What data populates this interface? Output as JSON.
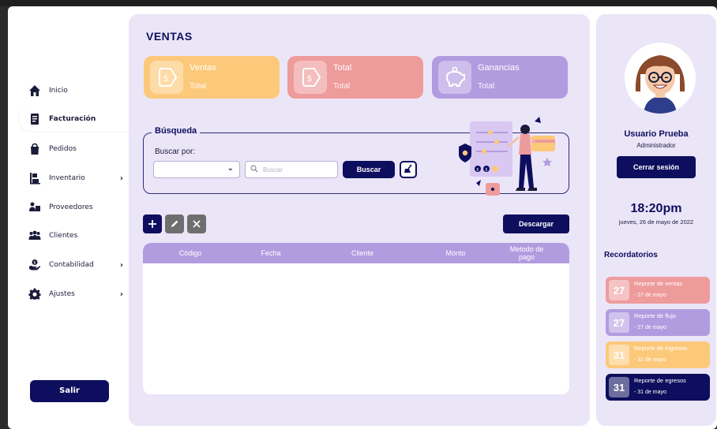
{
  "sidebar": {
    "items": [
      {
        "label": "Inicio",
        "icon": "home-icon",
        "has_submenu": false
      },
      {
        "label": "Facturación",
        "icon": "invoice-icon",
        "has_submenu": false,
        "active": true
      },
      {
        "label": "Pedidos",
        "icon": "shopping-bag-icon",
        "has_submenu": false
      },
      {
        "label": "Inventario",
        "icon": "inventory-icon",
        "has_submenu": true
      },
      {
        "label": "Proveedores",
        "icon": "suppliers-icon",
        "has_submenu": false
      },
      {
        "label": "Clientes",
        "icon": "clients-icon",
        "has_submenu": false
      },
      {
        "label": "Contabilidad",
        "icon": "accounting-icon",
        "has_submenu": true
      },
      {
        "label": "Ajustes",
        "icon": "gear-icon",
        "has_submenu": true
      }
    ],
    "chevron": "›",
    "logout_label": "Salir"
  },
  "main": {
    "title": "VENTAS",
    "cards": [
      {
        "label": "Ventas",
        "sub": "Total",
        "color": "#fcc97a",
        "icon": "price-tag-icon"
      },
      {
        "label": "Total",
        "sub": "Total",
        "color": "#ee9b9b",
        "icon": "price-tag-icon"
      },
      {
        "label": "Ganancias",
        "sub": "Total",
        "color": "#b29ce0",
        "icon": "piggy-bank-icon"
      }
    ],
    "search": {
      "legend": "Búsqueda",
      "by_label": "Buscar por:",
      "select_value": "",
      "input_placeholder": "Buscar",
      "button_label": "Buscar"
    },
    "toolbar": {
      "add_icon": "plus-icon",
      "edit_icon": "pencil-icon",
      "delete_icon": "x-icon",
      "download_label": "Descargar"
    },
    "table": {
      "columns": [
        "Código",
        "Fecha",
        "Cliente",
        "Monto",
        "Metodo de pago"
      ],
      "rows": []
    }
  },
  "user": {
    "name": "Usuario Prueba",
    "role": "Administrador",
    "logout_label": "Cerrar sesión",
    "time": "18:20pm",
    "date": "jueves, 26 de mayo de 2022"
  },
  "reminders": {
    "title": "Recordatorios",
    "items": [
      {
        "day": "27",
        "label": "Reporte de ventas",
        "date": "- 27 de mayo",
        "color": "#ee9b9b"
      },
      {
        "day": "27",
        "label": "Reporte de flujo",
        "date": "- 27 de mayo",
        "color": "#b29ce0"
      },
      {
        "day": "31",
        "label": "Reporte de ingresos",
        "date": "- 31 de mayo",
        "color": "#fcc97a"
      },
      {
        "day": "31",
        "label": "Reporte de egresos",
        "date": "- 31 de mayo",
        "color": "#0e0e5e"
      }
    ]
  },
  "colors": {
    "navy": "#0e0e5e",
    "lavender_bg": "#ebe5f8",
    "purple": "#b29ce0",
    "pink": "#ee9b9b",
    "orange": "#fcc97a"
  }
}
